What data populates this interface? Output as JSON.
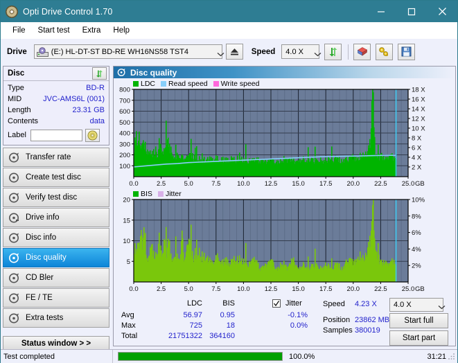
{
  "window": {
    "title": "Opti Drive Control 1.70",
    "icon": "disc-icon",
    "minimize": "minimize-icon",
    "maximize": "maximize-icon",
    "close": "close-icon"
  },
  "menu": {
    "items": [
      {
        "label": "File"
      },
      {
        "label": "Start test"
      },
      {
        "label": "Extra"
      },
      {
        "label": "Help"
      }
    ]
  },
  "toolbar": {
    "drive_label": "Drive",
    "drive_value": "(E:)  HL-DT-ST BD-RE  WH16NS58 TST4",
    "eject_icon": "eject-icon",
    "speed_label": "Speed",
    "speed_value": "4.0 X",
    "refresh_icon": "refresh-icon",
    "eraser_icon": "eraser-icon",
    "key_icon": "key-icon",
    "save_icon": "save-icon"
  },
  "disc_panel": {
    "title": "Disc",
    "refresh_icon": "refresh-icon",
    "rows": [
      {
        "key": "Type",
        "value": "BD-R"
      },
      {
        "key": "MID",
        "value": "JVC-AMS6L (001)"
      },
      {
        "key": "Length",
        "value": "23.31 GB"
      },
      {
        "key": "Contents",
        "value": "data"
      }
    ],
    "label_key": "Label",
    "label_value": "",
    "label_placeholder": "",
    "label_disc_icon": "disc-icon"
  },
  "sidebar": {
    "items": [
      {
        "label": "Transfer rate",
        "icon": "disc-test-icon",
        "active": false
      },
      {
        "label": "Create test disc",
        "icon": "disc-test-icon",
        "active": false
      },
      {
        "label": "Verify test disc",
        "icon": "disc-test-icon",
        "active": false
      },
      {
        "label": "Drive info",
        "icon": "disc-info-icon",
        "active": false
      },
      {
        "label": "Disc info",
        "icon": "disc-info-icon",
        "active": false
      },
      {
        "label": "Disc quality",
        "icon": "disc-quality-icon",
        "active": true
      },
      {
        "label": "CD Bler",
        "icon": "disc-test-icon",
        "active": false
      },
      {
        "label": "FE / TE",
        "icon": "disc-test-icon",
        "active": false
      },
      {
        "label": "Extra tests",
        "icon": "disc-test-icon",
        "active": false
      }
    ],
    "status_window_label": "Status window > >"
  },
  "main": {
    "header_title": "Disc quality",
    "header_icon": "disc-quality-icon"
  },
  "results": {
    "col_ldc": "LDC",
    "col_bis": "BIS",
    "jitter_label": "Jitter",
    "jitter_checked": true,
    "rows": [
      {
        "label": "Avg",
        "ldc": "56.97",
        "bis": "0.95",
        "jitter": "-0.1%"
      },
      {
        "label": "Max",
        "ldc": "725",
        "bis": "18",
        "jitter": "0.0%"
      },
      {
        "label": "Total",
        "ldc": "21751322",
        "bis": "364160",
        "jitter": ""
      }
    ],
    "speed_label": "Speed",
    "speed_value": "4.23 X",
    "speed_select": "4.0 X",
    "position_label": "Position",
    "position_value": "23862 MB",
    "samples_label": "Samples",
    "samples_value": "380019",
    "start_full_label": "Start full",
    "start_part_label": "Start part"
  },
  "statusbar": {
    "text": "Test completed",
    "percent_label": "100.0%",
    "percent_value": 100,
    "time": "31:21"
  },
  "chart_data": [
    {
      "type": "area",
      "id": "ldc-chart",
      "title": "",
      "xlabel": "GB",
      "ylabel": "LDC",
      "legend": [
        {
          "name": "LDC",
          "color": "#00b400"
        },
        {
          "name": "Read speed",
          "color": "#87cefa"
        },
        {
          "name": "Write speed",
          "color": "#ff69dc"
        }
      ],
      "legend_position": "top-left",
      "grid": true,
      "xlim": [
        0.0,
        25.0
      ],
      "xticks": [
        "0.0",
        "2.5",
        "5.0",
        "7.5",
        "10.0",
        "12.5",
        "15.0",
        "17.5",
        "20.0",
        "22.5",
        "25.0"
      ],
      "x_unit": "GB",
      "ylim": [
        0,
        800
      ],
      "yticks": [
        100,
        200,
        300,
        400,
        500,
        600,
        700,
        800
      ],
      "y2lim": [
        0,
        18
      ],
      "y2ticks": [
        "2 X",
        "4 X",
        "6 X",
        "8 X",
        "10 X",
        "12 X",
        "14 X",
        "16 X",
        "18 X"
      ],
      "data_end_gb": 23.9,
      "series": [
        {
          "name": "LDC",
          "color": "#00b400",
          "x": [
            0.05,
            0.2,
            0.35,
            0.5,
            0.7,
            0.9,
            1.1,
            1.3,
            1.5,
            1.8,
            2.1,
            2.4,
            2.7,
            3.0,
            3.3,
            3.6,
            3.9,
            4.2,
            4.5,
            4.8,
            5.1,
            5.5,
            5.9,
            6.3,
            6.7,
            7.1,
            7.5,
            8.0,
            8.5,
            9.0,
            9.5,
            10.0,
            10.6,
            11.2,
            11.8,
            12.4,
            13.0,
            13.6,
            14.2,
            14.8,
            15.4,
            16.0,
            16.6,
            17.2,
            17.8,
            18.4,
            19.0,
            19.6,
            20.2,
            20.8,
            21.3,
            21.6,
            21.75,
            21.85,
            22.0,
            22.3,
            22.7,
            23.1,
            23.5,
            23.85
          ],
          "y": [
            255,
            350,
            300,
            330,
            260,
            265,
            245,
            215,
            205,
            200,
            190,
            235,
            210,
            300,
            225,
            195,
            175,
            185,
            170,
            160,
            175,
            165,
            150,
            145,
            150,
            140,
            160,
            140,
            145,
            140,
            135,
            150,
            135,
            140,
            135,
            140,
            130,
            135,
            140,
            135,
            150,
            140,
            135,
            140,
            145,
            150,
            140,
            150,
            160,
            175,
            200,
            330,
            725,
            560,
            230,
            165,
            170,
            175,
            170,
            165
          ]
        },
        {
          "name": "Read speed",
          "color": "#87cefa",
          "x": [
            0.0,
            1.0,
            2.0,
            3.0,
            4.0,
            5.0,
            6.0,
            7.0,
            8.0,
            9.0,
            10.0,
            11.0,
            12.0,
            13.0,
            14.0,
            15.0,
            16.0,
            17.0,
            18.0,
            19.0,
            20.0,
            21.0,
            22.0,
            23.0,
            23.9
          ],
          "y": [
            2.0,
            2.2,
            2.4,
            2.6,
            2.7,
            2.9,
            3.0,
            3.1,
            3.2,
            3.3,
            3.4,
            3.5,
            3.6,
            3.7,
            3.8,
            3.9,
            4.0,
            4.1,
            4.15,
            4.2,
            4.25,
            4.3,
            4.35,
            4.4,
            4.4
          ]
        }
      ]
    },
    {
      "type": "area",
      "id": "bis-chart",
      "title": "",
      "xlabel": "GB",
      "ylabel": "BIS",
      "legend": [
        {
          "name": "BIS",
          "color": "#00b400"
        },
        {
          "name": "Jitter",
          "color": "#d8b0e8"
        }
      ],
      "legend_position": "top-left",
      "grid": true,
      "xlim": [
        0.0,
        25.0
      ],
      "xticks": [
        "0.0",
        "2.5",
        "5.0",
        "7.5",
        "10.0",
        "12.5",
        "15.0",
        "17.5",
        "20.0",
        "22.5",
        "25.0"
      ],
      "x_unit": "GB",
      "ylim": [
        0,
        20
      ],
      "yticks": [
        5,
        10,
        15,
        20
      ],
      "y2lim": [
        0,
        10
      ],
      "y2ticks": [
        "2%",
        "4%",
        "6%",
        "8%",
        "10%"
      ],
      "data_end_gb": 23.9,
      "series": [
        {
          "name": "BIS",
          "color": "#7ac70c",
          "x": [
            0.05,
            0.2,
            0.35,
            0.5,
            0.65,
            0.8,
            0.95,
            1.1,
            1.25,
            1.4,
            1.6,
            1.8,
            2.0,
            2.2,
            2.4,
            2.6,
            2.8,
            3.0,
            3.2,
            3.4,
            3.6,
            3.8,
            4.0,
            4.2,
            4.4,
            4.6,
            4.8,
            5.0,
            5.3,
            5.6,
            5.9,
            6.2,
            6.5,
            6.8,
            7.1,
            7.4,
            7.7,
            8.0,
            8.4,
            8.8,
            9.2,
            9.6,
            10.0,
            10.5,
            11.0,
            11.5,
            12.0,
            12.5,
            13.0,
            13.5,
            14.0,
            14.5,
            15.0,
            15.5,
            16.0,
            16.5,
            17.0,
            17.5,
            18.0,
            18.5,
            19.0,
            19.5,
            20.0,
            20.5,
            21.0,
            21.4,
            21.7,
            21.8,
            21.95,
            22.2,
            22.5,
            22.9,
            23.3,
            23.7,
            23.85
          ],
          "y": [
            8,
            6,
            10,
            7,
            14,
            6,
            13,
            7,
            5,
            6,
            9,
            6,
            5,
            8,
            7,
            6,
            10,
            6,
            9,
            5,
            6,
            7,
            5,
            6,
            11,
            5,
            7,
            9,
            6,
            5,
            7,
            5,
            6,
            5,
            4,
            5,
            6,
            4,
            5,
            4,
            5,
            4,
            5,
            4,
            5,
            3,
            4,
            5,
            3,
            4,
            3,
            5,
            3,
            4,
            3,
            4,
            3,
            4,
            3,
            4,
            3,
            5,
            4,
            6,
            5,
            8,
            12,
            18,
            10,
            6,
            4,
            5,
            4,
            5,
            4
          ]
        }
      ]
    }
  ]
}
